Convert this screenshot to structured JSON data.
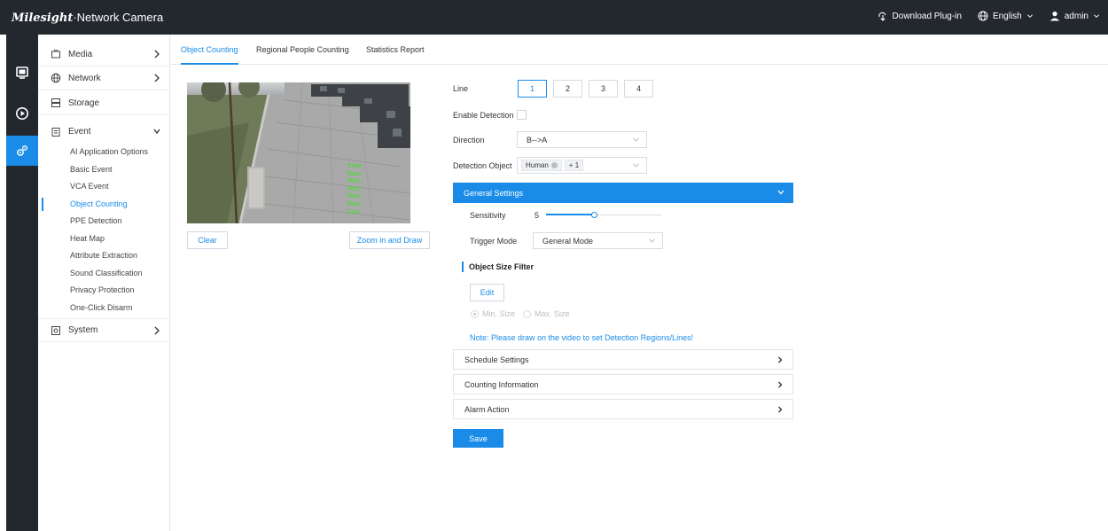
{
  "header": {
    "brand_logo": "Milesight",
    "brand_title": "·Network Camera",
    "download": "Download Plug-in",
    "language": "English",
    "user": "admin"
  },
  "rail": {
    "items": [
      "live-view-icon",
      "playback-icon",
      "settings-icon"
    ]
  },
  "sidebar": {
    "media": "Media",
    "network": "Network",
    "storage": "Storage",
    "event": "Event",
    "event_items": [
      "AI Application Options",
      "Basic Event",
      "VCA Event",
      "Object Counting",
      "PPE Detection",
      "Heat Map",
      "Attribute Extraction",
      "Sound Classification",
      "Privacy Protection",
      "One-Click Disarm"
    ],
    "system": "System"
  },
  "tabs": [
    "Object Counting",
    "Regional People Counting",
    "Statistics Report"
  ],
  "video": {
    "overlay_lines": [
      "Ente",
      "Pass",
      "Pers",
      "Pers",
      "Pers",
      "Pers",
      "Curr"
    ]
  },
  "buttons": {
    "clear": "Clear",
    "zoom_draw": "Zoom in and Draw",
    "edit": "Edit",
    "save": "Save"
  },
  "form": {
    "line_label": "Line",
    "lines": [
      "1",
      "2",
      "3",
      "4"
    ],
    "enable_detection": "Enable Detection",
    "direction_label": "Direction",
    "direction_value": "B-->A",
    "detection_object_label": "Detection Object",
    "detection_chip": "Human",
    "detection_more": "+ 1"
  },
  "general": {
    "title": "General Settings",
    "sensitivity_label": "Sensitivity",
    "sensitivity_value": "5",
    "sensitivity_fraction": 0.42,
    "trigger_label": "Trigger Mode",
    "trigger_value": "General Mode",
    "size_filter_title": "Object Size Filter",
    "min_size": "Min. Size",
    "max_size": "Max. Size",
    "note": "Note: Please draw on the video to set Detection Regions/Lines!"
  },
  "sections": {
    "schedule": "Schedule Settings",
    "counting": "Counting Information",
    "alarm": "Alarm Action"
  },
  "colors": {
    "accent": "#1a8ce8",
    "topbar": "#23272e",
    "overlay_text": "#39e61c"
  }
}
